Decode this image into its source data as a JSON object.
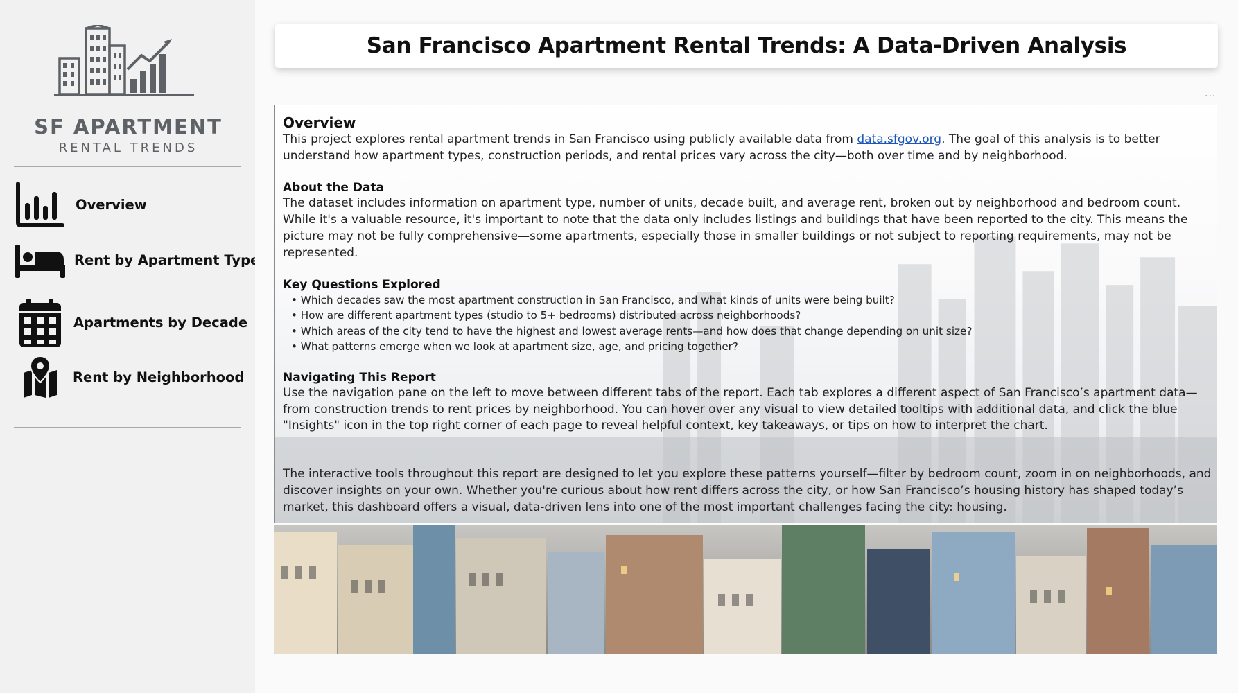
{
  "sidebar": {
    "logo": {
      "title": "SF APARTMENT",
      "subtitle": "RENTAL  TRENDS"
    },
    "items": [
      {
        "label": "Overview",
        "icon": "bar-chart-icon"
      },
      {
        "label": "Rent by Apartment Type",
        "icon": "bed-icon"
      },
      {
        "label": "Apartments by Decade",
        "icon": "calendar-icon"
      },
      {
        "label": "Rent by Neighborhood",
        "icon": "map-pin-icon"
      }
    ]
  },
  "header": {
    "title": "San Francisco Apartment Rental Trends: A Data-Driven Analysis"
  },
  "content": {
    "overview": {
      "heading": "Overview",
      "text_before_link": "This project explores rental apartment trends in San Francisco using publicly available data from ",
      "link": "data.sfgov.org",
      "text_after_link": ". The goal of this analysis is to better understand how apartment types, construction periods, and rental prices vary across the city—both over time and by neighborhood."
    },
    "about": {
      "heading": "About the Data",
      "text": "The dataset includes information on apartment type, number of units, decade built, and average rent, broken out by neighborhood and bedroom count. While it's a valuable resource, it's important to note that the data only includes listings and buildings that have been reported to the city. This means the picture may not be fully comprehensive—some apartments, especially those in smaller buildings or not subject to reporting requirements, may not be represented."
    },
    "questions": {
      "heading": "Key Questions Explored",
      "items": [
        "Which decades saw the most apartment construction in San Francisco, and what kinds of units were being built?",
        "How are different apartment types (studio to 5+ bedrooms) distributed across neighborhoods?",
        "Which areas of the city tend to have the highest and lowest average rents—and how does that change depending on unit size?",
        "What patterns emerge when we look at apartment size, age, and pricing together?"
      ]
    },
    "navigating": {
      "heading": "Navigating This Report",
      "text": "Use the navigation pane on the left to move between different tabs of the report. Each tab explores a different aspect of San Francisco’s apartment data—from construction trends to rent prices by neighborhood. You can hover over any visual to view detailed tooltips with additional data, and click the blue \"Insights\" icon in the top right corner of each page to reveal helpful context, key takeaways, or tips on how to interpret the chart."
    },
    "closing": "The interactive tools throughout this report are designed to let you explore these patterns yourself—filter by bedroom count, zoom in on neighborhoods, and discover insights on your own. Whether you're curious about how rent differs across the city, or how San Francisco’s housing history has shaped today’s market, this dashboard offers a visual, data-driven lens into one of the most important challenges facing the city: housing."
  },
  "more_options_label": "...",
  "colors": {
    "link": "#1a56b8",
    "sidebar_bg": "#f1f1f1",
    "logo_gray": "#5e6266"
  }
}
